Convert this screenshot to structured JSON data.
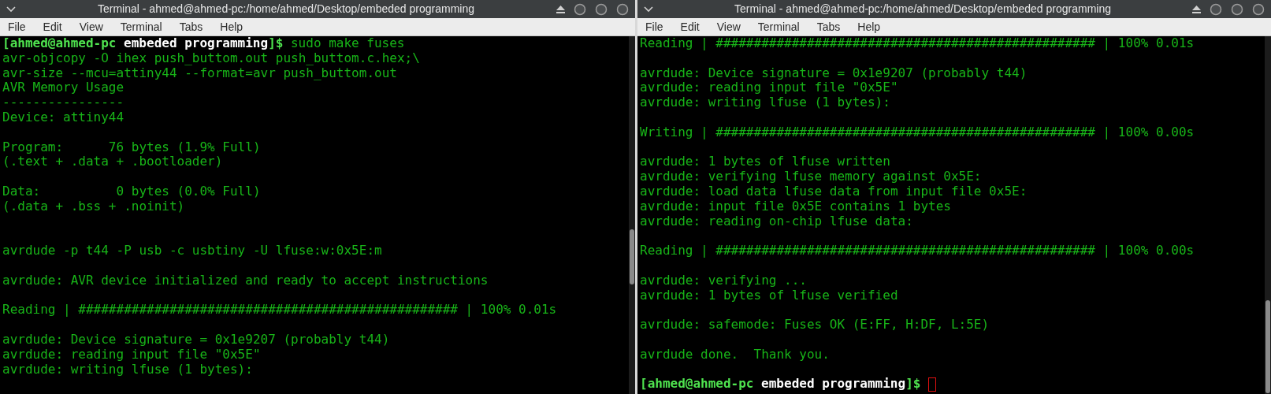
{
  "windows": [
    {
      "title": "Terminal - ahmed@ahmed-pc:/home/ahmed/Desktop/embeded programming",
      "menu": [
        "File",
        "Edit",
        "View",
        "Terminal",
        "Tabs",
        "Help"
      ],
      "lines": [
        {
          "kind": "prompt",
          "user": "[ahmed@ahmed-pc",
          "dir": "embeded programming",
          "symbol": "]$",
          "command": "sudo make fuses",
          "cursor": false
        },
        {
          "kind": "output",
          "text": "avr-objcopy -O ihex push_buttom.out push_buttom.c.hex;\\"
        },
        {
          "kind": "output",
          "text": "avr-size --mcu=attiny44 --format=avr push_buttom.out"
        },
        {
          "kind": "output",
          "text": "AVR Memory Usage"
        },
        {
          "kind": "output",
          "text": "----------------"
        },
        {
          "kind": "output",
          "text": "Device: attiny44"
        },
        {
          "kind": "blank"
        },
        {
          "kind": "output",
          "text": "Program:      76 bytes (1.9% Full)"
        },
        {
          "kind": "output",
          "text": "(.text + .data + .bootloader)"
        },
        {
          "kind": "blank"
        },
        {
          "kind": "output",
          "text": "Data:          0 bytes (0.0% Full)"
        },
        {
          "kind": "output",
          "text": "(.data + .bss + .noinit)"
        },
        {
          "kind": "blank"
        },
        {
          "kind": "blank"
        },
        {
          "kind": "output",
          "text": "avrdude -p t44 -P usb -c usbtiny -U lfuse:w:0x5E:m"
        },
        {
          "kind": "blank"
        },
        {
          "kind": "output",
          "text": "avrdude: AVR device initialized and ready to accept instructions"
        },
        {
          "kind": "blank"
        },
        {
          "kind": "output",
          "text": "Reading | ################################################## | 100% 0.01s"
        },
        {
          "kind": "blank"
        },
        {
          "kind": "output",
          "text": "avrdude: Device signature = 0x1e9207 (probably t44)"
        },
        {
          "kind": "output",
          "text": "avrdude: reading input file \"0x5E\""
        },
        {
          "kind": "output",
          "text": "avrdude: writing lfuse (1 bytes):"
        }
      ]
    },
    {
      "title": "Terminal - ahmed@ahmed-pc:/home/ahmed/Desktop/embeded programming",
      "menu": [
        "File",
        "Edit",
        "View",
        "Terminal",
        "Tabs",
        "Help"
      ],
      "lines": [
        {
          "kind": "output",
          "text": "Reading | ################################################## | 100% 0.01s"
        },
        {
          "kind": "blank"
        },
        {
          "kind": "output",
          "text": "avrdude: Device signature = 0x1e9207 (probably t44)"
        },
        {
          "kind": "output",
          "text": "avrdude: reading input file \"0x5E\""
        },
        {
          "kind": "output",
          "text": "avrdude: writing lfuse (1 bytes):"
        },
        {
          "kind": "blank"
        },
        {
          "kind": "output",
          "text": "Writing | ################################################## | 100% 0.00s"
        },
        {
          "kind": "blank"
        },
        {
          "kind": "output",
          "text": "avrdude: 1 bytes of lfuse written"
        },
        {
          "kind": "output",
          "text": "avrdude: verifying lfuse memory against 0x5E:"
        },
        {
          "kind": "output",
          "text": "avrdude: load data lfuse data from input file 0x5E:"
        },
        {
          "kind": "output",
          "text": "avrdude: input file 0x5E contains 1 bytes"
        },
        {
          "kind": "output",
          "text": "avrdude: reading on-chip lfuse data:"
        },
        {
          "kind": "blank"
        },
        {
          "kind": "output",
          "text": "Reading | ################################################## | 100% 0.00s"
        },
        {
          "kind": "blank"
        },
        {
          "kind": "output",
          "text": "avrdude: verifying ..."
        },
        {
          "kind": "output",
          "text": "avrdude: 1 bytes of lfuse verified"
        },
        {
          "kind": "blank"
        },
        {
          "kind": "output",
          "text": "avrdude: safemode: Fuses OK (E:FF, H:DF, L:5E)"
        },
        {
          "kind": "blank"
        },
        {
          "kind": "output",
          "text": "avrdude done.  Thank you."
        },
        {
          "kind": "blank"
        },
        {
          "kind": "prompt",
          "user": "[ahmed@ahmed-pc",
          "dir": "embeded programming",
          "symbol": "]$",
          "cursor": true
        }
      ]
    }
  ]
}
